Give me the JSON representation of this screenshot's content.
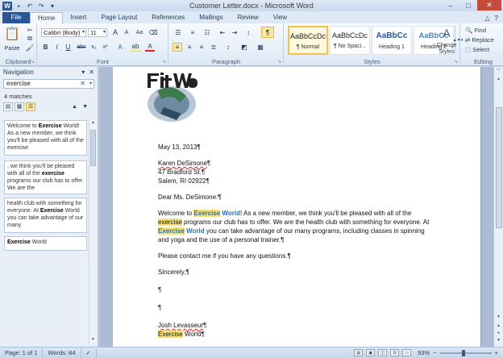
{
  "window": {
    "title": "Customer Letter.docx - Microsoft Word",
    "controls": [
      "–",
      "□",
      "✕"
    ]
  },
  "quick_access": {
    "app_icon": "W",
    "icons": [
      "save-icon",
      "undo-icon",
      "redo-icon",
      "customize-icon"
    ]
  },
  "tabs": [
    {
      "label": "File"
    },
    {
      "label": "Home"
    },
    {
      "label": "Insert"
    },
    {
      "label": "Page Layout"
    },
    {
      "label": "References"
    },
    {
      "label": "Mailings"
    },
    {
      "label": "Review"
    },
    {
      "label": "View"
    }
  ],
  "ribbon": {
    "clipboard": {
      "label": "Clipboard",
      "paste": "Paste"
    },
    "font": {
      "label": "Font",
      "family": "Calibri (Body)",
      "size": "11",
      "bold": "B",
      "italic": "I",
      "underline": "U",
      "grow": "A",
      "shrink": "A",
      "clear": "Aa",
      "font_color": "A"
    },
    "paragraph": {
      "label": "Paragraph",
      "pilcrow": "¶"
    },
    "styles": {
      "label": "Styles",
      "items": [
        {
          "sample": "AaBbCcDc",
          "name": "¶ Normal"
        },
        {
          "sample": "AaBbCcDc",
          "name": "¶ No Spaci..."
        },
        {
          "sample": "AaBbCc",
          "name": "Heading 1"
        },
        {
          "sample": "AaBbCc",
          "name": "Heading 2"
        }
      ],
      "change_styles": "Change Styles"
    },
    "editing": {
      "label": "Editing",
      "find": "Find",
      "replace": "Replace",
      "select": "Select"
    }
  },
  "navigation": {
    "title": "Navigation",
    "search_value": "exercise",
    "matches": "4 matches",
    "results": [
      {
        "before": "Welcome to ",
        "term": "Exercise",
        "after": " World! As a new member, we think you'll be pleased with all of the exercise"
      },
      {
        "before": ", we think you'll be pleased with all of the ",
        "term": "exercise",
        "after": " programs our club has to offer. We are the"
      },
      {
        "before": "health club with something for everyone. At ",
        "term": "Exercise",
        "after": " World you can take advantage of our many"
      },
      {
        "before": "",
        "term": "Exercise",
        "after": " World"
      }
    ]
  },
  "document": {
    "logo_text": "Fit World",
    "date": "May 13, 2013",
    "address": [
      "Karen DeSimone",
      "47 Bradford St.",
      "Salem, RI 02922"
    ],
    "salutation": "Dear Ms. DeSimone:",
    "body": {
      "p1_a": "Welcome to ",
      "p1_hl1": "Exercise",
      "p1_b": " World",
      "p1_c": "! As a new member, we think you'll be pleased with all of the ",
      "p1_hl2": "exercise",
      "p1_d": " programs our club has to offer. We are the health club with something for everyone. At ",
      "p1_hl3": "Exercise",
      "p1_e": " World",
      "p1_f": " you can take advantage of our many programs, including classes in spinning and yoga and the use of a personal trainer."
    },
    "contact": "Please contact me if you have any questions.",
    "closing": "Sincerely,",
    "pilcrow": "¶",
    "signature": "Josh Levasseur",
    "sign_hl": "Exercise",
    "sign_rest": " World"
  },
  "status": {
    "page": "Page: 1 of 1",
    "words": "Words: 84",
    "zoom": "93%",
    "zoom_level": 0.93
  },
  "colors": {
    "file_tab": "#2a5699",
    "highlight": "#f5e27a",
    "close": "#c74b3c"
  }
}
